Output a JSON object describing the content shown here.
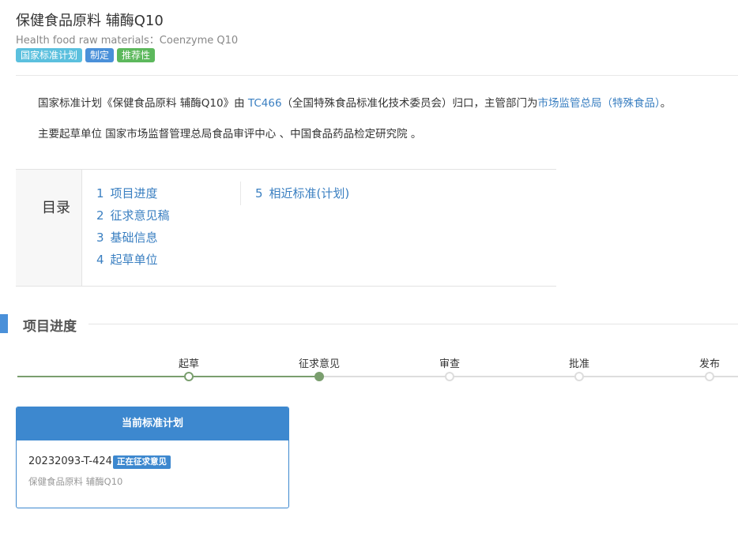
{
  "header": {
    "title": "保健食品原料 辅酶Q10",
    "subtitle": "Health food raw materials：Coenzyme Q10",
    "badges": [
      {
        "label": "国家标准计划",
        "color": "#5bc0de"
      },
      {
        "label": "制定",
        "color": "#4a90d9"
      },
      {
        "label": "推荐性",
        "color": "#5cb85c"
      }
    ]
  },
  "description": {
    "line1_prefix": "国家标准计划《保健食品原料 辅酶Q10》由 ",
    "tc_link": "TC466",
    "line1_middle": "（全国特殊食品标准化技术委员会）归口，主管部门为",
    "dept_link": "市场监管总局（特殊食品）",
    "line1_suffix": "。",
    "line2": "主要起草单位 国家市场监督管理总局食品审评中心 、中国食品药品检定研究院 。"
  },
  "toc": {
    "title": "目录",
    "items": [
      {
        "num": "1",
        "label": "项目进度"
      },
      {
        "num": "2",
        "label": "征求意见稿"
      },
      {
        "num": "3",
        "label": "基础信息"
      },
      {
        "num": "4",
        "label": "起草单位"
      },
      {
        "num": "5",
        "label": "相近标准(计划)"
      }
    ]
  },
  "progress": {
    "section_title": "项目进度",
    "stages": [
      "起草",
      "征求意见",
      "审查",
      "批准",
      "发布"
    ],
    "current_stage_index": 1,
    "colors": {
      "done": "#7a9e6e",
      "pending": "#dddddd"
    }
  },
  "card": {
    "header": "当前标准计划",
    "code": "20232093-T-424",
    "status": "正在征求意见",
    "name": "保健食品原料 辅酶Q10"
  }
}
